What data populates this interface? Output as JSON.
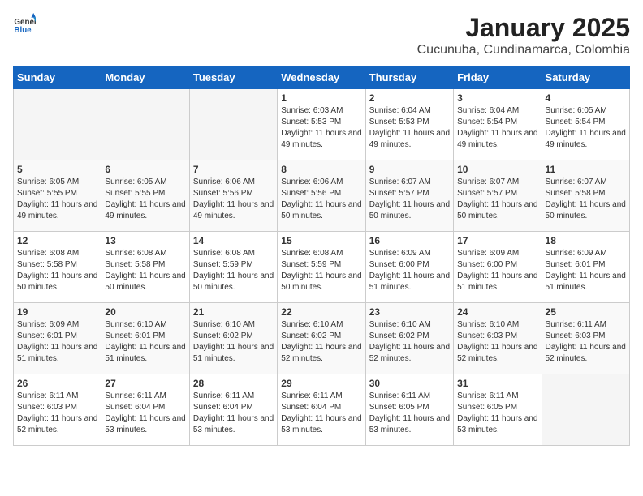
{
  "logo": {
    "general": "General",
    "blue": "Blue"
  },
  "title": "January 2025",
  "subtitle": "Cucunuba, Cundinamarca, Colombia",
  "days_of_week": [
    "Sunday",
    "Monday",
    "Tuesday",
    "Wednesday",
    "Thursday",
    "Friday",
    "Saturday"
  ],
  "weeks": [
    [
      {
        "day": "",
        "info": ""
      },
      {
        "day": "",
        "info": ""
      },
      {
        "day": "",
        "info": ""
      },
      {
        "day": "1",
        "info": "Sunrise: 6:03 AM\nSunset: 5:53 PM\nDaylight: 11 hours and 49 minutes."
      },
      {
        "day": "2",
        "info": "Sunrise: 6:04 AM\nSunset: 5:53 PM\nDaylight: 11 hours and 49 minutes."
      },
      {
        "day": "3",
        "info": "Sunrise: 6:04 AM\nSunset: 5:54 PM\nDaylight: 11 hours and 49 minutes."
      },
      {
        "day": "4",
        "info": "Sunrise: 6:05 AM\nSunset: 5:54 PM\nDaylight: 11 hours and 49 minutes."
      }
    ],
    [
      {
        "day": "5",
        "info": "Sunrise: 6:05 AM\nSunset: 5:55 PM\nDaylight: 11 hours and 49 minutes."
      },
      {
        "day": "6",
        "info": "Sunrise: 6:05 AM\nSunset: 5:55 PM\nDaylight: 11 hours and 49 minutes."
      },
      {
        "day": "7",
        "info": "Sunrise: 6:06 AM\nSunset: 5:56 PM\nDaylight: 11 hours and 49 minutes."
      },
      {
        "day": "8",
        "info": "Sunrise: 6:06 AM\nSunset: 5:56 PM\nDaylight: 11 hours and 50 minutes."
      },
      {
        "day": "9",
        "info": "Sunrise: 6:07 AM\nSunset: 5:57 PM\nDaylight: 11 hours and 50 minutes."
      },
      {
        "day": "10",
        "info": "Sunrise: 6:07 AM\nSunset: 5:57 PM\nDaylight: 11 hours and 50 minutes."
      },
      {
        "day": "11",
        "info": "Sunrise: 6:07 AM\nSunset: 5:58 PM\nDaylight: 11 hours and 50 minutes."
      }
    ],
    [
      {
        "day": "12",
        "info": "Sunrise: 6:08 AM\nSunset: 5:58 PM\nDaylight: 11 hours and 50 minutes."
      },
      {
        "day": "13",
        "info": "Sunrise: 6:08 AM\nSunset: 5:58 PM\nDaylight: 11 hours and 50 minutes."
      },
      {
        "day": "14",
        "info": "Sunrise: 6:08 AM\nSunset: 5:59 PM\nDaylight: 11 hours and 50 minutes."
      },
      {
        "day": "15",
        "info": "Sunrise: 6:08 AM\nSunset: 5:59 PM\nDaylight: 11 hours and 50 minutes."
      },
      {
        "day": "16",
        "info": "Sunrise: 6:09 AM\nSunset: 6:00 PM\nDaylight: 11 hours and 51 minutes."
      },
      {
        "day": "17",
        "info": "Sunrise: 6:09 AM\nSunset: 6:00 PM\nDaylight: 11 hours and 51 minutes."
      },
      {
        "day": "18",
        "info": "Sunrise: 6:09 AM\nSunset: 6:01 PM\nDaylight: 11 hours and 51 minutes."
      }
    ],
    [
      {
        "day": "19",
        "info": "Sunrise: 6:09 AM\nSunset: 6:01 PM\nDaylight: 11 hours and 51 minutes."
      },
      {
        "day": "20",
        "info": "Sunrise: 6:10 AM\nSunset: 6:01 PM\nDaylight: 11 hours and 51 minutes."
      },
      {
        "day": "21",
        "info": "Sunrise: 6:10 AM\nSunset: 6:02 PM\nDaylight: 11 hours and 51 minutes."
      },
      {
        "day": "22",
        "info": "Sunrise: 6:10 AM\nSunset: 6:02 PM\nDaylight: 11 hours and 52 minutes."
      },
      {
        "day": "23",
        "info": "Sunrise: 6:10 AM\nSunset: 6:02 PM\nDaylight: 11 hours and 52 minutes."
      },
      {
        "day": "24",
        "info": "Sunrise: 6:10 AM\nSunset: 6:03 PM\nDaylight: 11 hours and 52 minutes."
      },
      {
        "day": "25",
        "info": "Sunrise: 6:11 AM\nSunset: 6:03 PM\nDaylight: 11 hours and 52 minutes."
      }
    ],
    [
      {
        "day": "26",
        "info": "Sunrise: 6:11 AM\nSunset: 6:03 PM\nDaylight: 11 hours and 52 minutes."
      },
      {
        "day": "27",
        "info": "Sunrise: 6:11 AM\nSunset: 6:04 PM\nDaylight: 11 hours and 53 minutes."
      },
      {
        "day": "28",
        "info": "Sunrise: 6:11 AM\nSunset: 6:04 PM\nDaylight: 11 hours and 53 minutes."
      },
      {
        "day": "29",
        "info": "Sunrise: 6:11 AM\nSunset: 6:04 PM\nDaylight: 11 hours and 53 minutes."
      },
      {
        "day": "30",
        "info": "Sunrise: 6:11 AM\nSunset: 6:05 PM\nDaylight: 11 hours and 53 minutes."
      },
      {
        "day": "31",
        "info": "Sunrise: 6:11 AM\nSunset: 6:05 PM\nDaylight: 11 hours and 53 minutes."
      },
      {
        "day": "",
        "info": ""
      }
    ]
  ]
}
